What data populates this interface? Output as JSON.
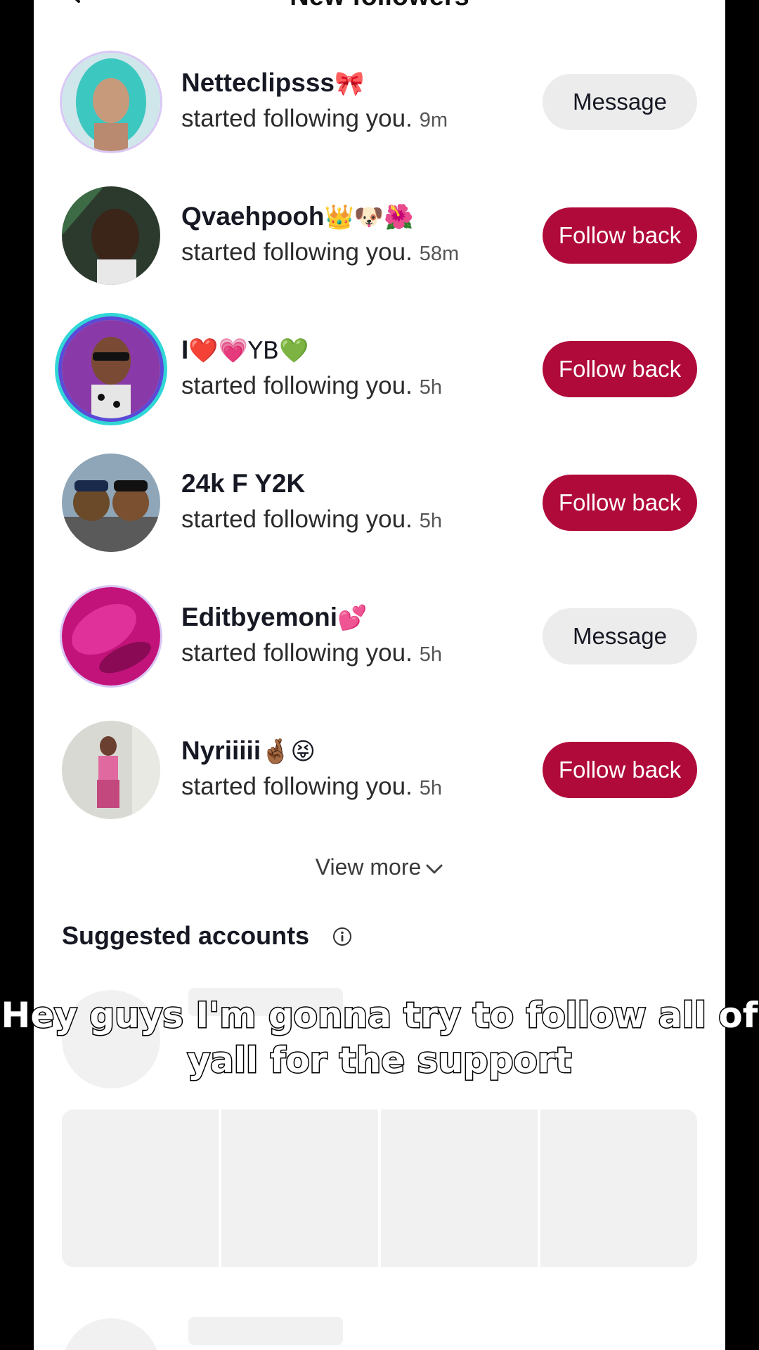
{
  "header": {
    "title": "New followers"
  },
  "followers": [
    {
      "name": "Netteclipsss",
      "emoji": "🎀",
      "subtitle": "started following you.",
      "time": "9m",
      "button": "Message"
    },
    {
      "name": "Qvaehpooh",
      "emoji": "👑🐶🌺",
      "subtitle": "started following you.",
      "time": "58m",
      "button": "Follow back"
    },
    {
      "name": "I",
      "emoji": "❤️💗YB💚",
      "subtitle": "started following you.",
      "time": "5h",
      "button": "Follow back"
    },
    {
      "name": "24k F Y2K",
      "emoji": "",
      "subtitle": "started following you.",
      "time": "5h",
      "button": "Follow back"
    },
    {
      "name": "Editbyemoni",
      "emoji": "💕",
      "subtitle": "started following you.",
      "time": "5h",
      "button": "Message"
    },
    {
      "name": "Nyriiiii",
      "emoji": "🤞🏾😝",
      "subtitle": "started following you.",
      "time": "5h",
      "button": "Follow back"
    }
  ],
  "view_more": "View more",
  "suggested": {
    "title": "Suggested accounts"
  },
  "caption": "Hey guys I'm gonna try to follow all of yall for the support",
  "colors": {
    "follow_back": "#b00a3a",
    "message_bg": "#ececec"
  }
}
